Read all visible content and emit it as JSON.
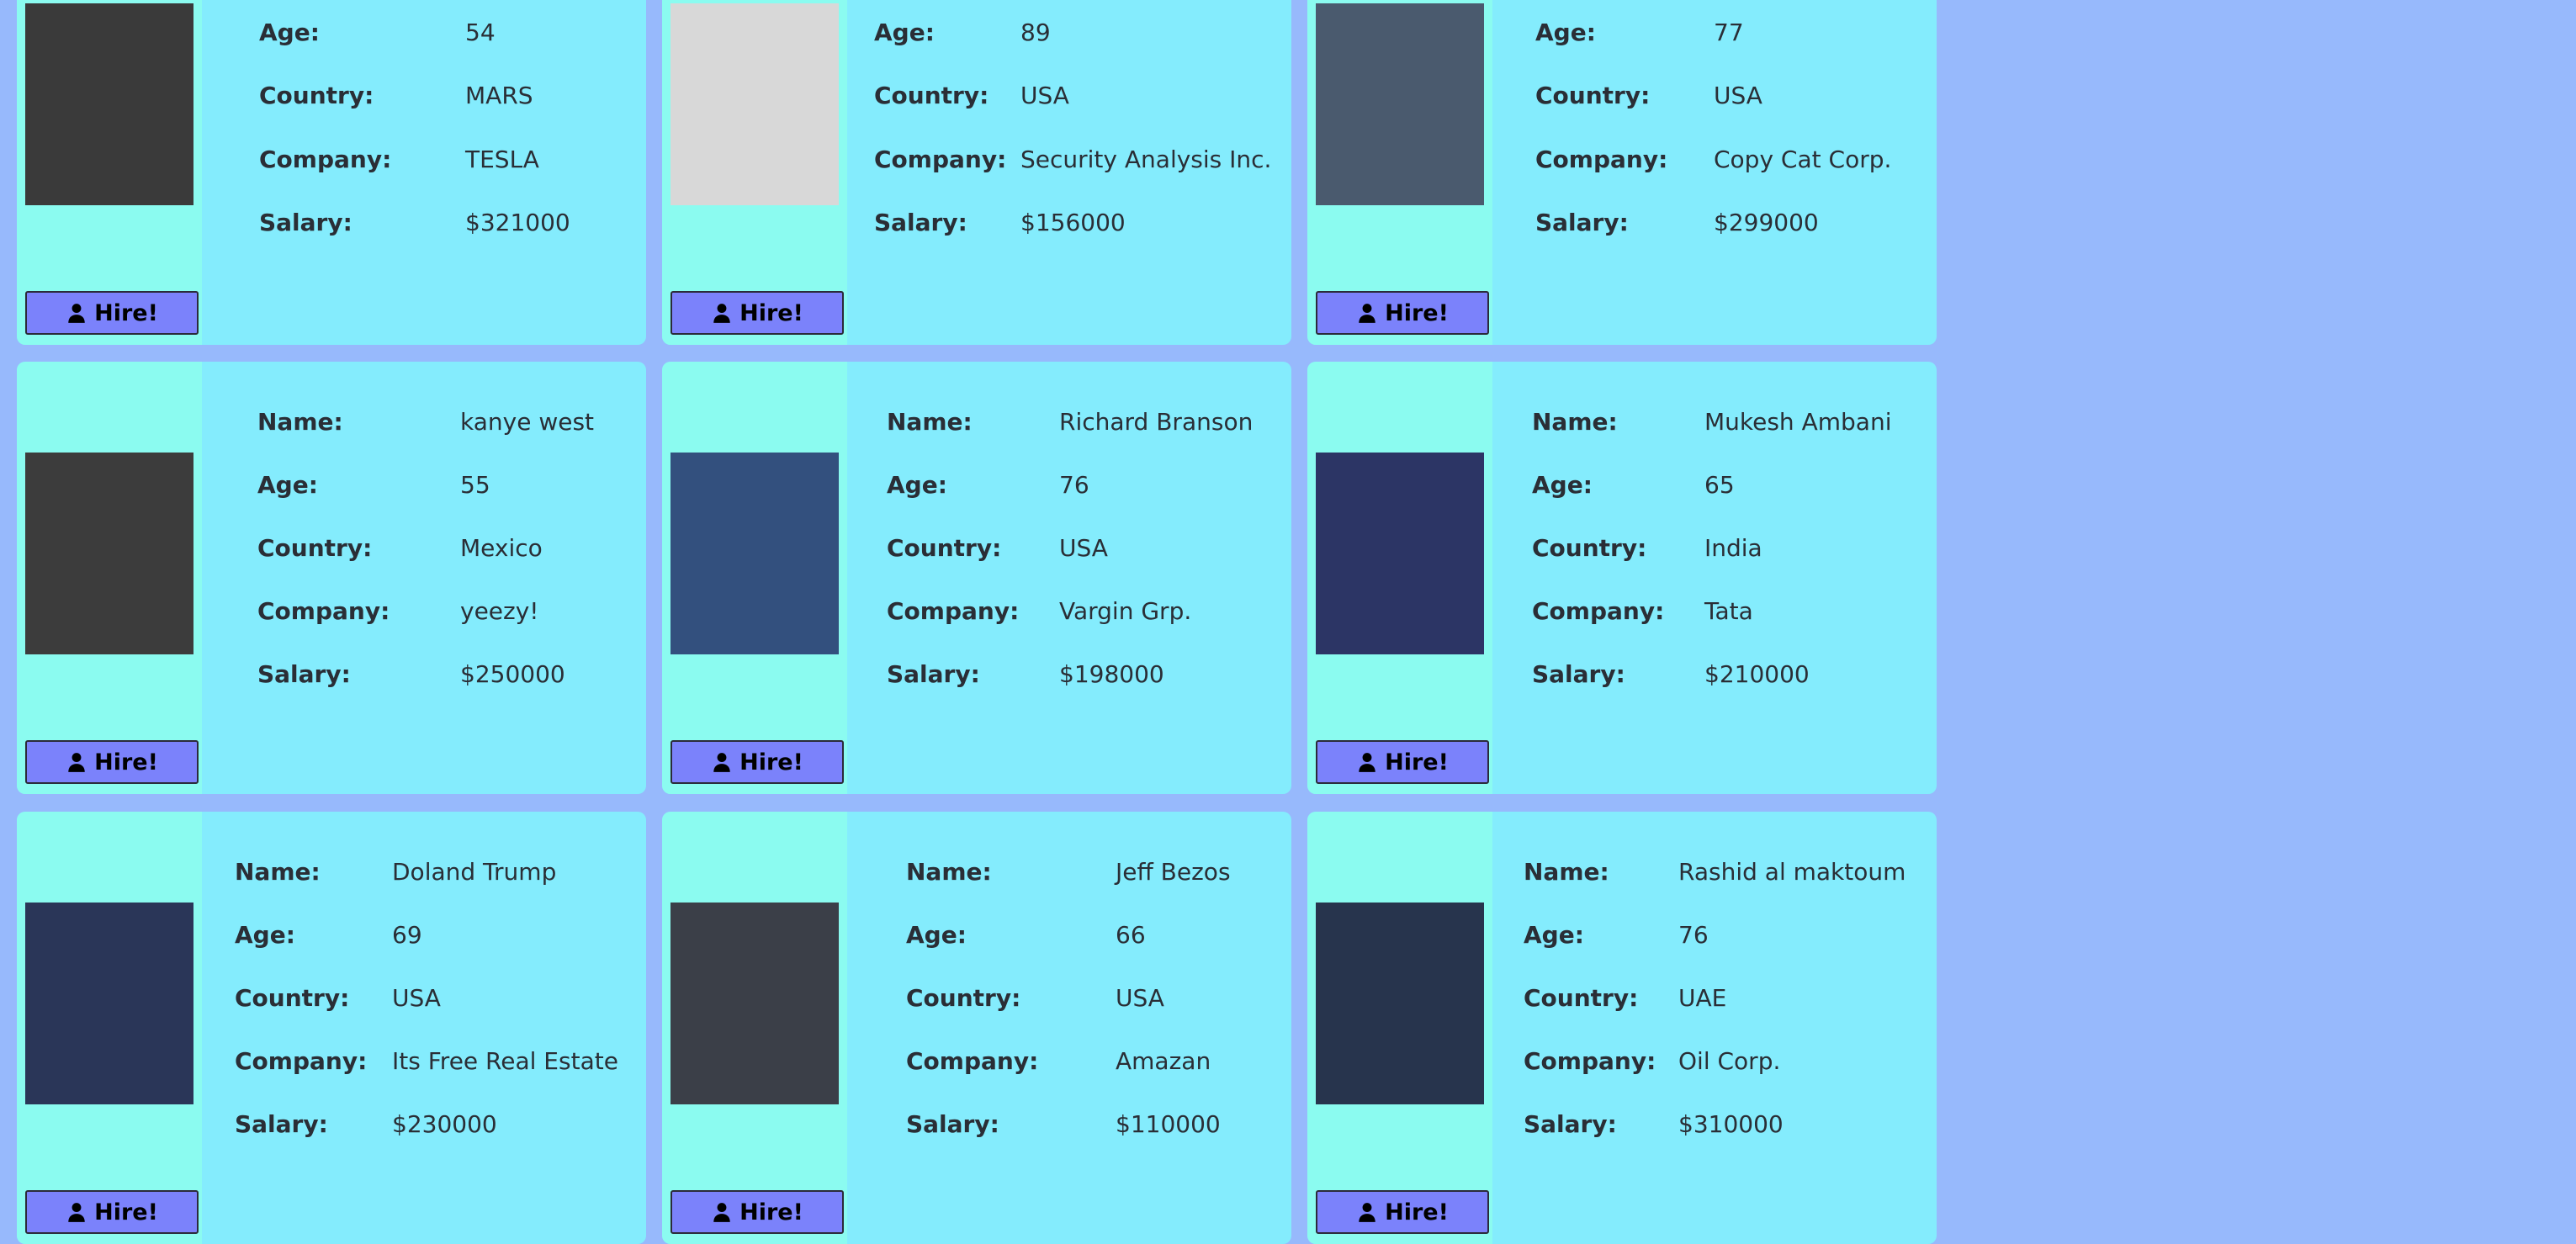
{
  "hire_label": "Hire!",
  "labels": {
    "name": "Name:",
    "age": "Age:",
    "country": "Country:",
    "company": "Company:",
    "salary": "Salary:"
  },
  "people": [
    {
      "age": "54",
      "country": "MARS",
      "company": "TESLA",
      "salary": "$321000"
    },
    {
      "age": "89",
      "country": "USA",
      "company": "Security Analysis Inc.",
      "salary": "$156000"
    },
    {
      "age": "77",
      "country": "USA",
      "company": "Copy Cat Corp.",
      "salary": "$299000"
    },
    {
      "name": "kanye west",
      "age": "55",
      "country": "Mexico",
      "company": "yeezy!",
      "salary": "$250000"
    },
    {
      "name": "Richard Branson",
      "age": "76",
      "country": "USA",
      "company": "Vargin Grp.",
      "salary": "$198000"
    },
    {
      "name": "Mukesh Ambani",
      "age": "65",
      "country": "India",
      "company": "Tata",
      "salary": "$210000"
    },
    {
      "name": "Doland Trump",
      "age": "69",
      "country": "USA",
      "company": "Its Free Real Estate",
      "salary": "$230000"
    },
    {
      "name": "Jeff Bezos",
      "age": "66",
      "country": "USA",
      "company": "Amazan",
      "salary": "$110000"
    },
    {
      "name": "Rashid al maktoum",
      "age": "76",
      "country": "UAE",
      "company": "Oil Corp.",
      "salary": "$310000"
    }
  ],
  "colors": {
    "page_bg": "#97b9fc",
    "card_bg": "#84ecfd",
    "photo_panel": "#8bfbf0",
    "hire_button": "#7b82fb"
  }
}
